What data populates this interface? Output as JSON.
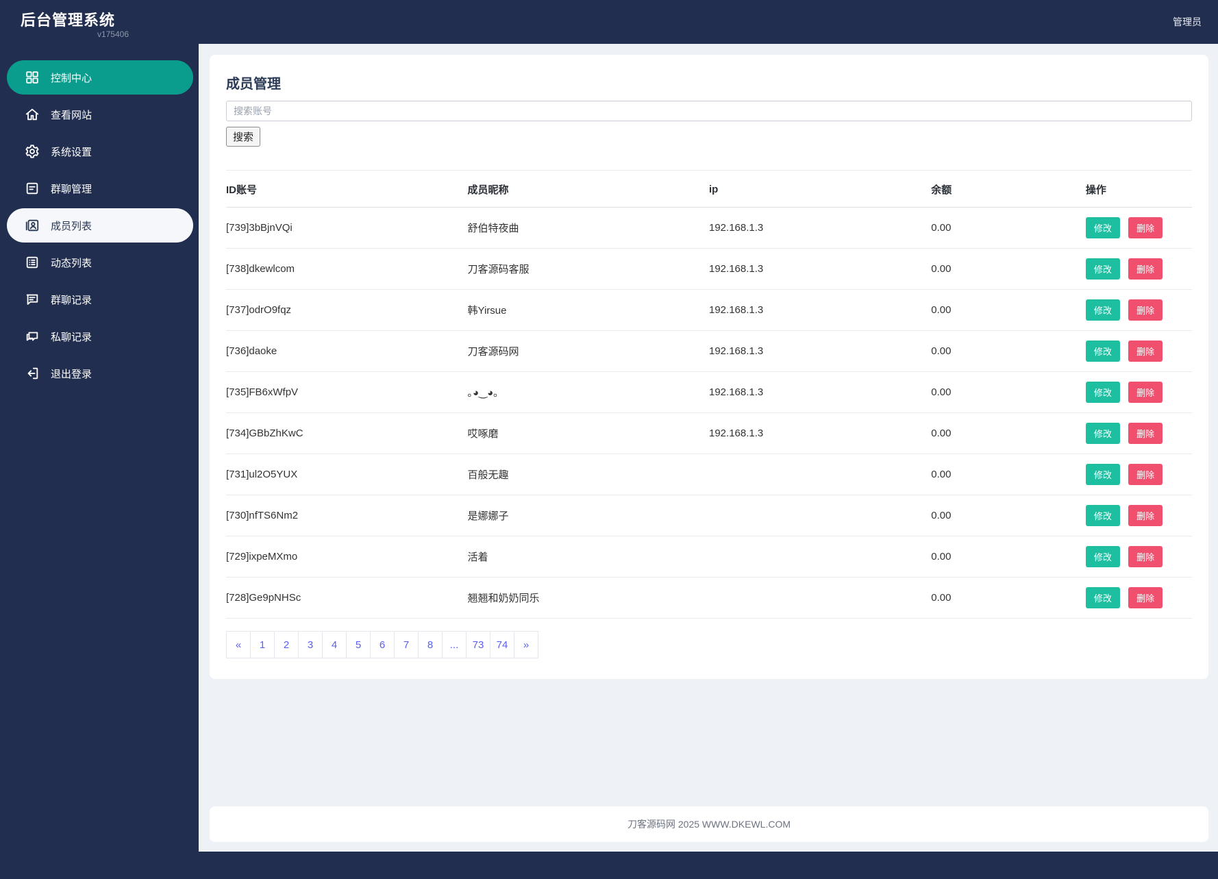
{
  "app": {
    "title": "后台管理系统",
    "version": "v175406",
    "user": "管理员"
  },
  "sidebar": {
    "items": [
      {
        "key": "control-center",
        "label": "控制中心",
        "icon": "dashboard-grid-icon",
        "state": "active-primary"
      },
      {
        "key": "view-site",
        "label": "查看网站",
        "icon": "home-icon",
        "state": ""
      },
      {
        "key": "system-settings",
        "label": "系统设置",
        "icon": "gear-icon",
        "state": ""
      },
      {
        "key": "group-manage",
        "label": "群聊管理",
        "icon": "message-square-icon",
        "state": ""
      },
      {
        "key": "member-list",
        "label": "成员列表",
        "icon": "member-card-icon",
        "state": "active-light"
      },
      {
        "key": "feed-list",
        "label": "动态列表",
        "icon": "list-detail-icon",
        "state": ""
      },
      {
        "key": "group-records",
        "label": "群聊记录",
        "icon": "comment-lines-icon",
        "state": ""
      },
      {
        "key": "private-records",
        "label": "私聊记录",
        "icon": "chat-bubbles-icon",
        "state": ""
      },
      {
        "key": "logout",
        "label": "退出登录",
        "icon": "logout-icon",
        "state": ""
      }
    ]
  },
  "page": {
    "title": "成员管理",
    "search_placeholder": "搜索账号",
    "search_button": "搜索"
  },
  "table": {
    "headers": [
      "ID账号",
      "成员昵称",
      "ip",
      "余额",
      "操作"
    ],
    "actions": {
      "edit": "修改",
      "delete": "删除"
    },
    "rows": [
      {
        "id": "[739]3bBjnVQi",
        "nickname": "舒伯特夜曲",
        "ip": "192.168.1.3",
        "balance": "0.00"
      },
      {
        "id": "[738]dkewlcom",
        "nickname": "刀客源码客服",
        "ip": "192.168.1.3",
        "balance": "0.00"
      },
      {
        "id": "[737]odrO9fqz",
        "nickname": "韩Yirsue",
        "ip": "192.168.1.3",
        "balance": "0.00"
      },
      {
        "id": "[736]daoke",
        "nickname": "刀客源码网",
        "ip": "192.168.1.3",
        "balance": "0.00"
      },
      {
        "id": "[735]FB6xWfpV",
        "nickname": "｡◕‿◕｡",
        "ip": "192.168.1.3",
        "balance": "0.00"
      },
      {
        "id": "[734]GBbZhKwC",
        "nickname": "哎啄磨",
        "ip": "192.168.1.3",
        "balance": "0.00"
      },
      {
        "id": "[731]ul2O5YUX",
        "nickname": "百般无趣",
        "ip": "",
        "balance": "0.00"
      },
      {
        "id": "[730]nfTS6Nm2",
        "nickname": "是娜娜子",
        "ip": "",
        "balance": "0.00"
      },
      {
        "id": "[729]ixpeMXmo",
        "nickname": "活着",
        "ip": "",
        "balance": "0.00"
      },
      {
        "id": "[728]Ge9pNHSc",
        "nickname": "翘翘和奶奶同乐",
        "ip": "",
        "balance": "0.00"
      }
    ]
  },
  "pagination": {
    "items": [
      "«",
      "1",
      "2",
      "3",
      "4",
      "5",
      "6",
      "7",
      "8",
      "...",
      "73",
      "74",
      "»"
    ]
  },
  "footer": {
    "text": "刀客源码网 2025 WWW.DKEWL.COM"
  },
  "colors": {
    "navy": "#212e4f",
    "active_item": "#0a9d8d",
    "edit_button": "#1dbfa0",
    "delete_button": "#f0506e",
    "pagination_link": "#5a5ff0",
    "content_bg": "#eef1f6"
  }
}
